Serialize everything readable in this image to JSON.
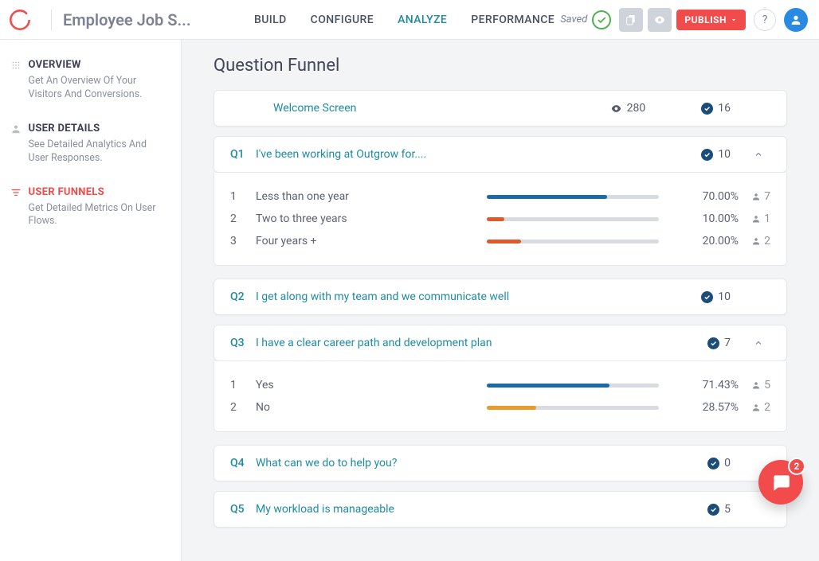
{
  "header": {
    "project_title": "Employee Job S...",
    "tabs": [
      "BUILD",
      "CONFIGURE",
      "ANALYZE",
      "PERFORMANCE"
    ],
    "active_tab_index": 2,
    "saved_label": "Saved",
    "publish_label": "PUBLISH",
    "help_label": "?"
  },
  "sidebar": [
    {
      "title": "OVERVIEW",
      "desc": "Get An Overview Of Your Visitors And Conversions.",
      "active": false,
      "icon": "grid"
    },
    {
      "title": "USER DETAILS",
      "desc": "See Detailed Analytics And User Responses.",
      "active": false,
      "icon": "user"
    },
    {
      "title": "USER FUNNELS",
      "desc": "Get Detailed Metrics On User Flows.",
      "active": true,
      "icon": "funnel"
    }
  ],
  "page": {
    "title": "Question Funnel"
  },
  "welcome": {
    "label": "Welcome Screen",
    "views": "280",
    "completions": "16"
  },
  "questions": [
    {
      "num": "Q1",
      "text": "I've been working at Outgrow for....",
      "completions": "10",
      "expanded": true,
      "options": [
        {
          "idx": "1",
          "label": "Less than one year",
          "pct": 70,
          "pct_label": "70.00%",
          "users": "7",
          "color": "#1b6aa8"
        },
        {
          "idx": "2",
          "label": "Two to three years",
          "pct": 10,
          "pct_label": "10.00%",
          "users": "1",
          "color": "#e2582a"
        },
        {
          "idx": "3",
          "label": "Four years +",
          "pct": 20,
          "pct_label": "20.00%",
          "users": "2",
          "color": "#e2582a"
        }
      ]
    },
    {
      "num": "Q2",
      "text": "I get along with my team and we communicate well",
      "completions": "10",
      "expanded": false
    },
    {
      "num": "Q3",
      "text": "I have a clear career path and development plan",
      "completions": "7",
      "expanded": true,
      "options": [
        {
          "idx": "1",
          "label": "Yes",
          "pct": 71.43,
          "pct_label": "71.43%",
          "users": "5",
          "color": "#1b6aa8"
        },
        {
          "idx": "2",
          "label": "No",
          "pct": 28.57,
          "pct_label": "28.57%",
          "users": "2",
          "color": "#e89a2a"
        }
      ]
    },
    {
      "num": "Q4",
      "text": "What can we do to help you?",
      "completions": "0",
      "expanded": false
    },
    {
      "num": "Q5",
      "text": "My workload is manageable",
      "completions": "5",
      "expanded": false
    }
  ],
  "chat": {
    "unread": "2"
  }
}
